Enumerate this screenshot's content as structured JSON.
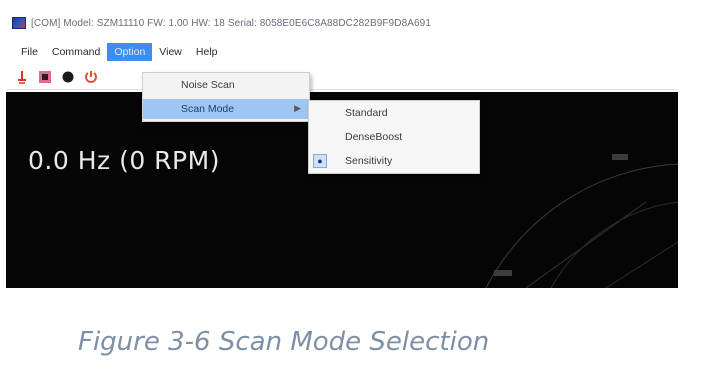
{
  "window": {
    "title": "[COM] Model: SZM11110 FW: 1.00 HW: 18 Serial: 8058E0E6C8A88DC282B9F9D8A691",
    "icon": "app-icon"
  },
  "menubar": {
    "items": [
      "File",
      "Command",
      "Option",
      "View",
      "Help"
    ],
    "active": "Option"
  },
  "toolbar": {
    "buttons": [
      "laser-icon",
      "stop-icon",
      "record-icon",
      "reset-icon"
    ]
  },
  "option_menu": {
    "items": [
      {
        "label": "Noise Scan",
        "has_submenu": false
      },
      {
        "label": "Scan Mode",
        "has_submenu": true,
        "highlighted": true
      }
    ]
  },
  "scan_mode_submenu": {
    "items": [
      {
        "label": "Standard",
        "checked": false
      },
      {
        "label": "DenseBoost",
        "checked": false
      },
      {
        "label": "Sensitivity",
        "checked": true
      }
    ]
  },
  "display": {
    "frequency_text": "0.0 Hz (0 RPM)",
    "background": "#050505",
    "grid_color": "#3a3a3a"
  },
  "colors": {
    "menu_active": "#3d8ef0",
    "menu_highlight": "#9fc6f3"
  },
  "caption": "Figure 3-6 Scan Mode Selection"
}
